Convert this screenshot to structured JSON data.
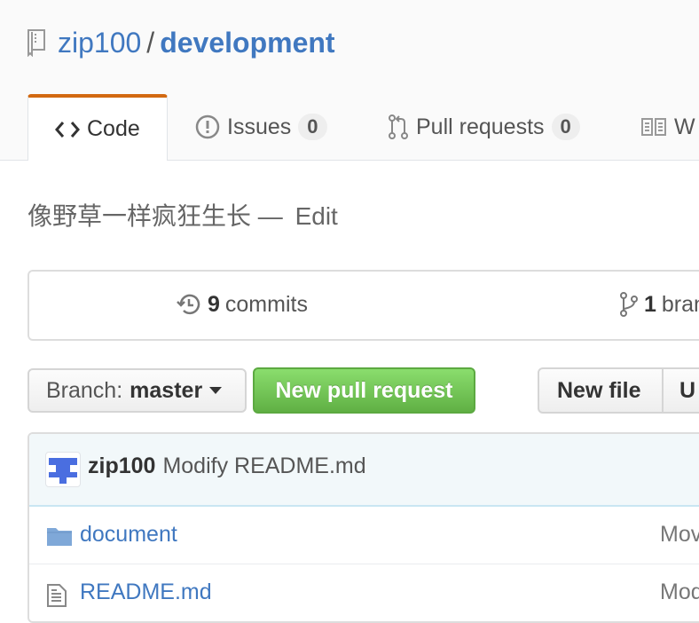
{
  "repo": {
    "owner": "zip100",
    "separator": "/",
    "name": "development"
  },
  "tabs": [
    {
      "label": "Code"
    },
    {
      "label": "Issues",
      "count": "0"
    },
    {
      "label": "Pull requests",
      "count": "0"
    },
    {
      "label": "W"
    }
  ],
  "description": {
    "text": "像野草一样疯狂生长",
    "dash": "—",
    "edit_label": "Edit"
  },
  "summary": {
    "commits_count": "9",
    "commits_label": "commits",
    "branches_count": "1",
    "branches_label": "bran"
  },
  "toolbar": {
    "branch_prefix": "Branch:",
    "branch_name": "master",
    "new_pull_request": "New pull request",
    "new_file": "New file",
    "upload": "U"
  },
  "latest_commit": {
    "author": "zip100",
    "message": "Modify README.md"
  },
  "files": [
    {
      "name": "document",
      "type": "folder",
      "commit_message": "Mov"
    },
    {
      "name": "README.md",
      "type": "file",
      "commit_message": "Mod"
    }
  ],
  "colors": {
    "link": "#4078c0",
    "accent_tab": "#d26911",
    "green_button": "#60b044",
    "avatar": "#4a6ee0"
  }
}
